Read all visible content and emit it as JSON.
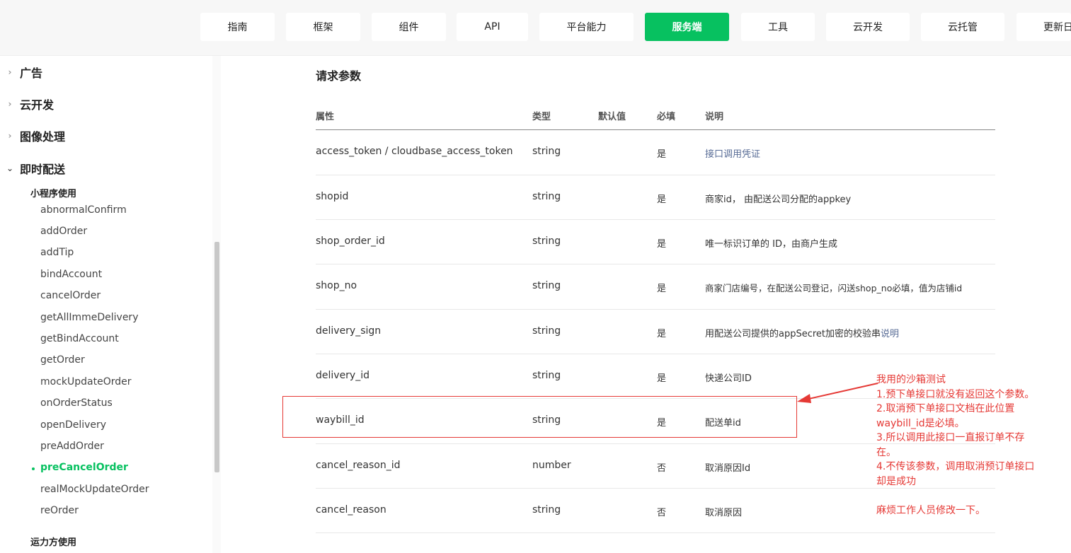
{
  "top_nav": {
    "tabs": [
      {
        "label": "指南",
        "active": false
      },
      {
        "label": "框架",
        "active": false
      },
      {
        "label": "组件",
        "active": false
      },
      {
        "label": "API",
        "active": false
      },
      {
        "label": "平台能力",
        "active": false
      },
      {
        "label": "服务端",
        "active": true
      },
      {
        "label": "工具",
        "active": false
      },
      {
        "label": "云开发",
        "active": false
      },
      {
        "label": "云托管",
        "active": false
      },
      {
        "label": "更新日",
        "active": false
      }
    ]
  },
  "sidebar": {
    "categories": [
      {
        "label": "广告",
        "expanded": false
      },
      {
        "label": "云开发",
        "expanded": false
      },
      {
        "label": "图像处理",
        "expanded": false
      },
      {
        "label": "即时配送",
        "expanded": true
      }
    ],
    "subgroup_label": "小程序使用",
    "items": [
      "abnormalConfirm",
      "addOrder",
      "addTip",
      "bindAccount",
      "cancelOrder",
      "getAllImmeDelivery",
      "getBindAccount",
      "getOrder",
      "mockUpdateOrder",
      "onOrderStatus",
      "openDelivery",
      "preAddOrder",
      "preCancelOrder",
      "realMockUpdateOrder",
      "reOrder"
    ],
    "active_item": "preCancelOrder",
    "subgroup2_label": "运力方使用"
  },
  "content": {
    "section_title": "请求参数",
    "headers": {
      "attr": "属性",
      "type": "类型",
      "default": "默认值",
      "required": "必填",
      "desc": "说明"
    },
    "rows": [
      {
        "attr": "access_token / cloudbase_access_token",
        "type": "string",
        "required": "是",
        "desc": "",
        "link": "接口调用凭证"
      },
      {
        "attr": "shopid",
        "type": "string",
        "required": "是",
        "desc": "商家id， 由配送公司分配的appkey",
        "link": ""
      },
      {
        "attr": "shop_order_id",
        "type": "string",
        "required": "是",
        "desc": "唯一标识订单的 ID，由商户生成",
        "link": ""
      },
      {
        "attr": "shop_no",
        "type": "string",
        "required": "是",
        "desc": "商家门店编号，在配送公司登记，闪送shop_no必填，值为店铺id",
        "link": ""
      },
      {
        "attr": "delivery_sign",
        "type": "string",
        "required": "是",
        "desc": "用配送公司提供的appSecret加密的校验串",
        "link": "说明"
      },
      {
        "attr": "delivery_id",
        "type": "string",
        "required": "是",
        "desc": "快递公司ID",
        "link": ""
      },
      {
        "attr": "waybill_id",
        "type": "string",
        "required": "是",
        "desc": "配送单id",
        "link": ""
      },
      {
        "attr": "cancel_reason_id",
        "type": "number",
        "required": "否",
        "desc": "取消原因Id",
        "link": ""
      },
      {
        "attr": "cancel_reason",
        "type": "string",
        "required": "否",
        "desc": "取消原因",
        "link": ""
      }
    ]
  },
  "annotation": {
    "color": "#e53935",
    "lines": [
      "我用的沙箱测试",
      "1.预下单接口就没有返回这个参数。",
      "2.取消预下单接口文档在此位置",
      "waybill_id是必填。",
      "3.所以调用此接口一直报订单不存",
      "在。",
      "4.不传该参数，调用取消预订单接口",
      "却是成功",
      "",
      "麻烦工作人员修改一下。"
    ]
  }
}
